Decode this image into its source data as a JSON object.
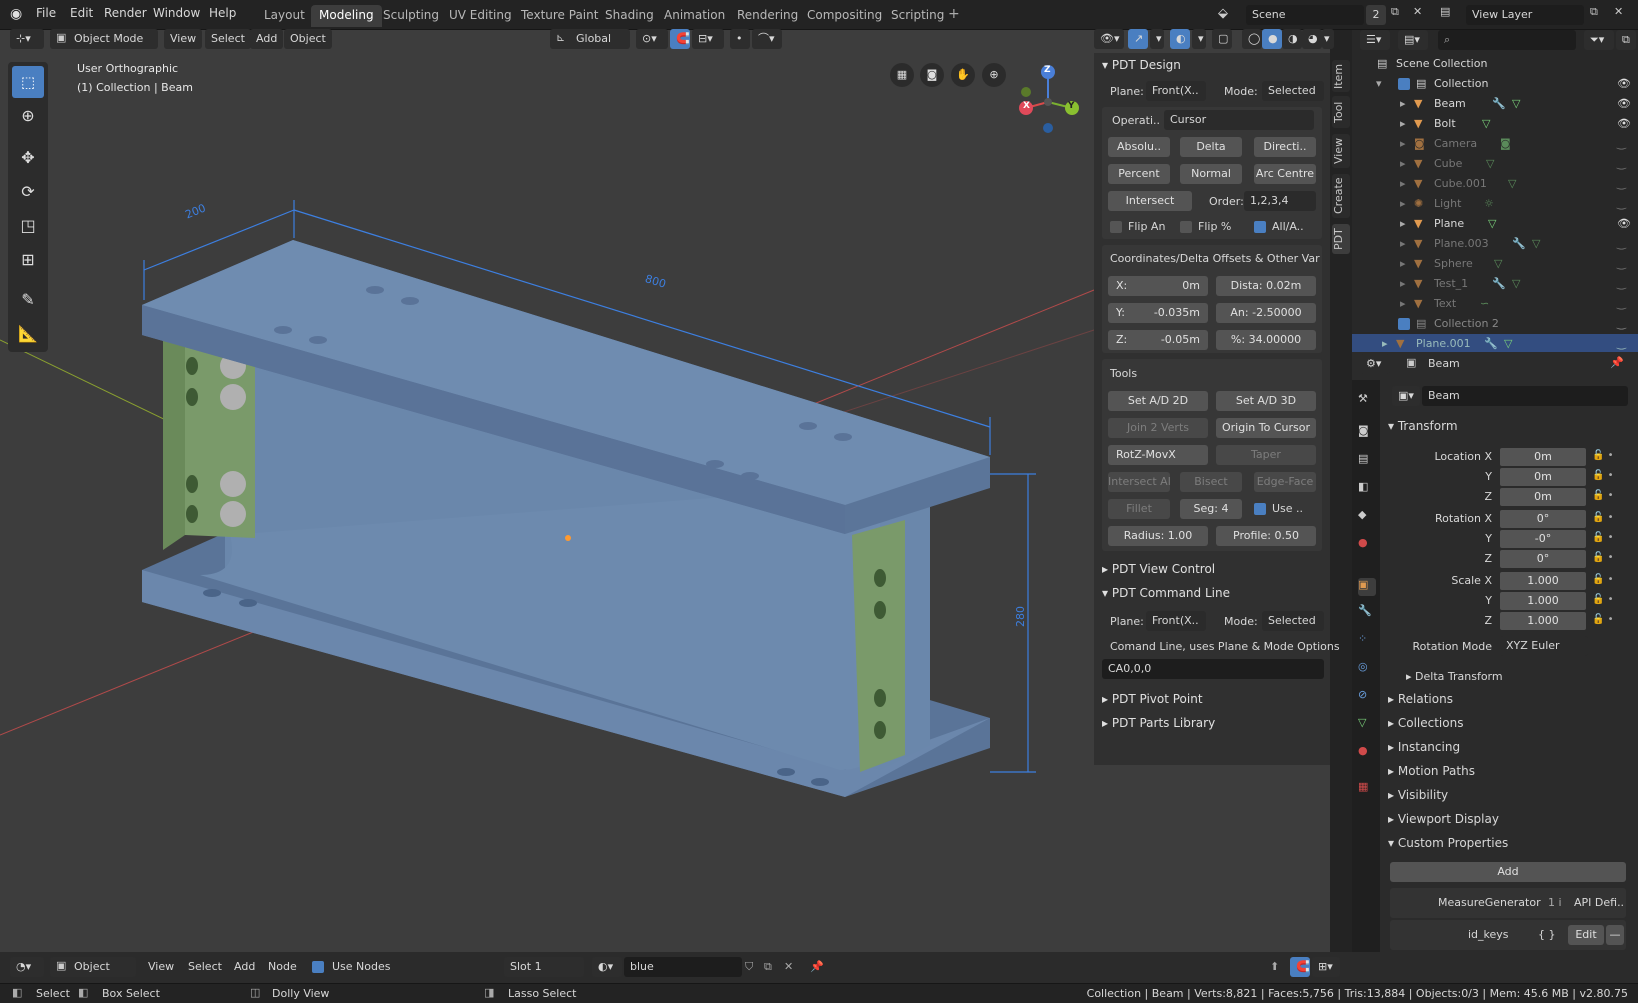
{
  "menu": {
    "file": "File",
    "edit": "Edit",
    "render": "Render",
    "window": "Window",
    "help": "Help"
  },
  "workspaces": [
    "Layout",
    "Modeling",
    "Sculpting",
    "UV Editing",
    "Texture Paint",
    "Shading",
    "Animation",
    "Rendering",
    "Compositing",
    "Scripting"
  ],
  "scene": {
    "name": "Scene",
    "count": "2",
    "view_layer": "View Layer"
  },
  "viewport": {
    "mode": "Object Mode",
    "menus": [
      "View",
      "Select",
      "Add",
      "Object"
    ],
    "orientation": "Global",
    "view_name": "User Orthographic",
    "collection_info": "(1) Collection | Beam",
    "dim_200": "200",
    "dim_800": "800",
    "dim_280": "280",
    "gizmo": {
      "x": "X",
      "y": "Y",
      "z": "Z"
    }
  },
  "pdt": {
    "title": "PDT Design",
    "plane_label": "Plane:",
    "plane_value": "Front(X..",
    "mode_label": "Mode:",
    "mode_value": "Selected",
    "operation_label": "Operati..",
    "operation_value": "Cursor",
    "buttons_row1": [
      "Absolu..",
      "Delta",
      "Directi.."
    ],
    "buttons_row2": [
      "Percent",
      "Normal",
      "Arc Centre"
    ],
    "intersect": "Intersect",
    "order_label": "Order:",
    "order_value": "1,2,3,4",
    "flip_an": "Flip An",
    "flip_pct": "Flip %",
    "all_a": "All/A..",
    "coords_title": "Coordinates/Delta Offsets & Other Vari..",
    "x_label": "X:",
    "x_value": "0m",
    "dista_label": "Dista:",
    "dista_value": "0.02m",
    "y_label": "Y:",
    "y_value": "-0.035m",
    "an_label": "An:",
    "an_value": "-2.50000",
    "z_label": "Z:",
    "z_value": "-0.05m",
    "pct_label": "%:",
    "pct_value": "34.00000",
    "tools_title": "Tools",
    "set_ad_2d": "Set A/D 2D",
    "set_ad_3d": "Set A/D 3D",
    "join_2_verts": "Join 2 Verts",
    "origin_to_cursor": "Origin To Cursor",
    "rotz": "RotZ-MovX",
    "taper": "Taper",
    "intersect_all": "Intersect All",
    "bisect": "Bisect",
    "edge_face": "Edge-Face",
    "fillet": "Fillet",
    "seg": "Seg:  4",
    "use": "Use ..",
    "radius": "Radius:  1.00",
    "profile": "Profile:  0.50",
    "view_control": "PDT View Control",
    "command_line": "PDT Command Line",
    "cmd_plane_label": "Plane:",
    "cmd_plane_value": "Front(X..",
    "cmd_mode_label": "Mode:",
    "cmd_mode_value": "Selected",
    "cmd_desc": "Comand Line, uses Plane & Mode Options",
    "cmd_value": "CA0,0,0",
    "pivot_point": "PDT Pivot Point",
    "parts_library": "PDT Parts Library"
  },
  "side_tabs": [
    "Item",
    "Tool",
    "View",
    "Create",
    "PDT"
  ],
  "outliner": {
    "root": "Scene Collection",
    "items": [
      "Collection",
      "Beam",
      "Bolt",
      "Camera",
      "Cube",
      "Cube.001",
      "Light",
      "Plane",
      "Plane.003",
      "Sphere",
      "Test_1",
      "Text",
      "Collection 2",
      "Plane.001"
    ]
  },
  "properties": {
    "object_name": "Beam",
    "name_field": "Beam",
    "transform": "Transform",
    "location_x": "Location X",
    "loc_y": "Y",
    "loc_z": "Z",
    "loc_values": [
      "0m",
      "0m",
      "0m"
    ],
    "rotation_x": "Rotation X",
    "rot_y": "Y",
    "rot_z": "Z",
    "rot_values": [
      "0°",
      "-0°",
      "0°"
    ],
    "scale_x": "Scale X",
    "scale_y": "Y",
    "scale_z": "Z",
    "scale_values": [
      "1.000",
      "1.000",
      "1.000"
    ],
    "rotation_mode_label": "Rotation Mode",
    "rotation_mode": "XYZ Euler",
    "delta_transform": "Delta Transform",
    "sections": [
      "Relations",
      "Collections",
      "Instancing",
      "Motion Paths",
      "Visibility",
      "Viewport Display",
      "Custom Properties"
    ],
    "add": "Add",
    "measure_gen": "MeasureGenerator",
    "measure_val": "1 i",
    "api": "API Defi..",
    "id_keys": "id_keys",
    "id_val": "{ }",
    "edit": "Edit",
    "minus": "—"
  },
  "bottom": {
    "editor": "Object",
    "menus": [
      "View",
      "Select",
      "Add",
      "Node"
    ],
    "use_nodes": "Use Nodes",
    "slot": "Slot 1",
    "material": "blue"
  },
  "statusbar": {
    "select": "Select",
    "box_select": "Box Select",
    "dolly": "Dolly View",
    "lasso": "Lasso Select",
    "info": "Collection | Beam | Verts:8,821 | Faces:5,756 | Tris:13,884 | Objects:0/3 | Mem: 45.6 MB | v2.80.75"
  },
  "colors": {
    "accent": "#4a7fc1",
    "beam": "#6a87ab",
    "plate": "#7a9a6a",
    "dim": "#3d7fe0"
  }
}
